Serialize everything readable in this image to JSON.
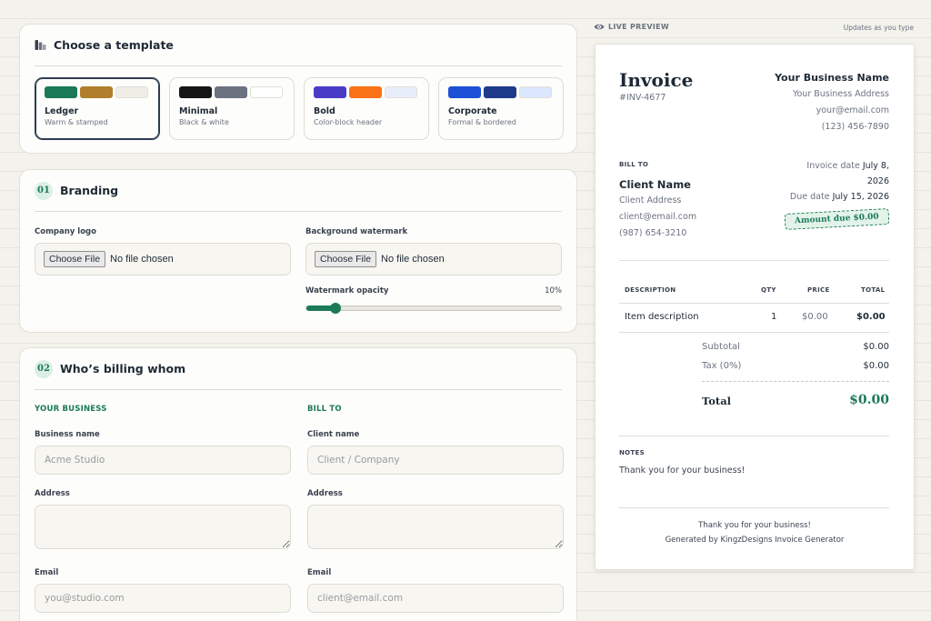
{
  "templates_card": {
    "title": "Choose a template",
    "templates": [
      {
        "name": "Ledger",
        "desc": "Warm & stamped",
        "colors": [
          "#1a7a55",
          "#b07f2c",
          "#efede6"
        ],
        "selected": true
      },
      {
        "name": "Minimal",
        "desc": "Black & white",
        "colors": [
          "#161616",
          "#6b7280",
          "#ffffff"
        ],
        "selected": false
      },
      {
        "name": "Bold",
        "desc": "Color-block header",
        "colors": [
          "#4a3bc7",
          "#f97316",
          "#e8edfb"
        ],
        "selected": false
      },
      {
        "name": "Corporate",
        "desc": "Formal & bordered",
        "colors": [
          "#1d4fd7",
          "#1e3a8a",
          "#dbe7fc"
        ],
        "selected": false
      }
    ]
  },
  "branding": {
    "step": "01",
    "title": "Branding",
    "logo_label": "Company logo",
    "watermark_label": "Background watermark",
    "file_button": "Choose File",
    "file_status": "No file chosen",
    "opacity_label": "Watermark opacity",
    "opacity_value": "10%",
    "opacity_fraction": 0.1
  },
  "billing": {
    "step": "02",
    "title": "Who’s billing whom",
    "your_business": "YOUR BUSINESS",
    "bill_to": "BILL TO",
    "business_name_label": "Business name",
    "business_name_placeholder": "Acme Studio",
    "client_name_label": "Client name",
    "client_name_placeholder": "Client / Company",
    "address_label": "Address",
    "email_label": "Email",
    "business_email_placeholder": "you@studio.com",
    "client_email_placeholder": "client@email.com"
  },
  "preview": {
    "label": "LIVE PREVIEW",
    "updates": "Updates as you type",
    "title": "Invoice",
    "number": "#INV-4677",
    "business": {
      "name": "Your Business Name",
      "address": "Your Business Address",
      "email": "your@email.com",
      "phone": "(123) 456-7890"
    },
    "bill_to_label": "BILL TO",
    "client": {
      "name": "Client Name",
      "address": "Client Address",
      "email": "client@email.com",
      "phone": "(987) 654-3210"
    },
    "invoice_date_label": "Invoice date",
    "invoice_date_1": "July 8,",
    "invoice_date_2": "2026",
    "due_date_label": "Due date",
    "due_date": "July 15, 2026",
    "amount_due": "Amount due $0.00",
    "columns": {
      "description": "DESCRIPTION",
      "qty": "QTY",
      "price": "PRICE",
      "total": "TOTAL"
    },
    "rows": [
      {
        "description": "Item description",
        "qty": "1",
        "price": "$0.00",
        "total": "$0.00"
      }
    ],
    "subtotal_label": "Subtotal",
    "subtotal": "$0.00",
    "tax_label": "Tax (0%)",
    "tax": "$0.00",
    "total_label": "Total",
    "total": "$0.00",
    "notes_label": "NOTES",
    "notes": "Thank you for your business!",
    "footer_1": "Thank you for your business!",
    "footer_2": "Generated by KingzDesigns Invoice Generator"
  }
}
